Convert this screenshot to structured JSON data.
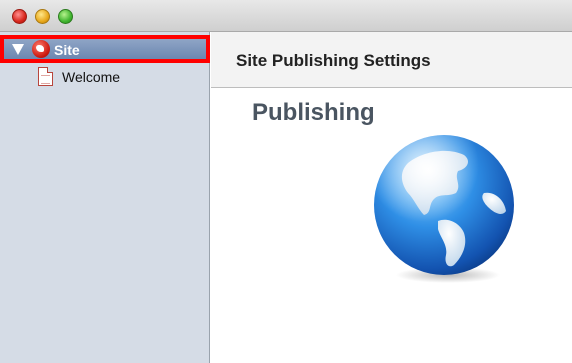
{
  "window": {
    "controls": [
      "close",
      "minimize",
      "zoom"
    ]
  },
  "sidebar": {
    "items": [
      {
        "label": "Site",
        "icon": "site-globe-icon",
        "selected": true,
        "expanded": true
      },
      {
        "label": "Welcome",
        "icon": "page-icon",
        "selected": false
      }
    ]
  },
  "main": {
    "header_title": "Site Publishing Settings",
    "section_heading": "Publishing",
    "illustration": "globe-icon"
  },
  "colors": {
    "highlight_outline": "#ff0000",
    "sidebar_background": "#d5dce6",
    "selection": "#6c87b0"
  }
}
